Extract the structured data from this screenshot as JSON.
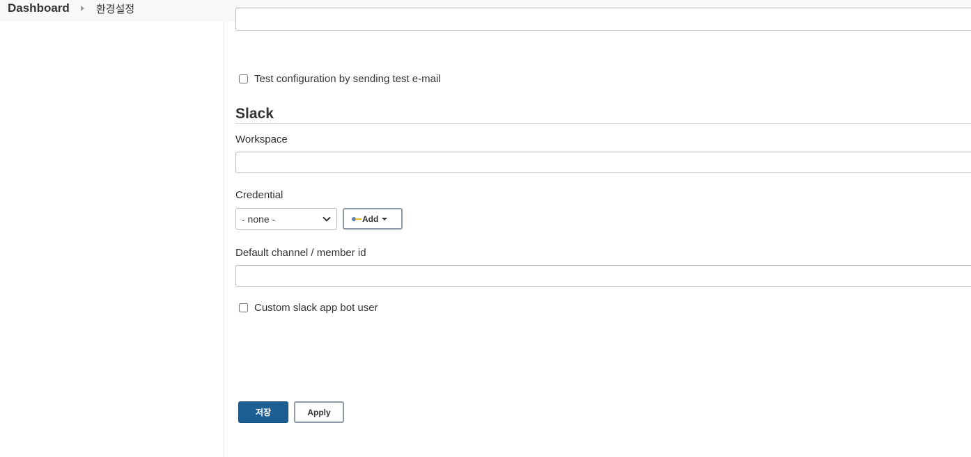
{
  "breadcrumb": {
    "root": "Dashboard",
    "current": "환경설정"
  },
  "email": {
    "test_checkbox_label": "Test configuration by sending test e-mail",
    "test_checked": false
  },
  "slack": {
    "title": "Slack",
    "workspace_label": "Workspace",
    "workspace_value": "",
    "credential_label": "Credential",
    "credential_selected": "- none -",
    "add_button_label": "Add",
    "channel_label": "Default channel / member id",
    "channel_value": "",
    "custom_bot_label": "Custom slack app bot user",
    "custom_bot_checked": false
  },
  "actions": {
    "save_label": "저장",
    "apply_label": "Apply"
  },
  "colors": {
    "save_button": "#1d5f92",
    "breadcrumb_bg": "#f8f8f8"
  },
  "icons": {
    "credential_add": "key-icon",
    "breadcrumb_separator": "chevron-right-icon"
  }
}
